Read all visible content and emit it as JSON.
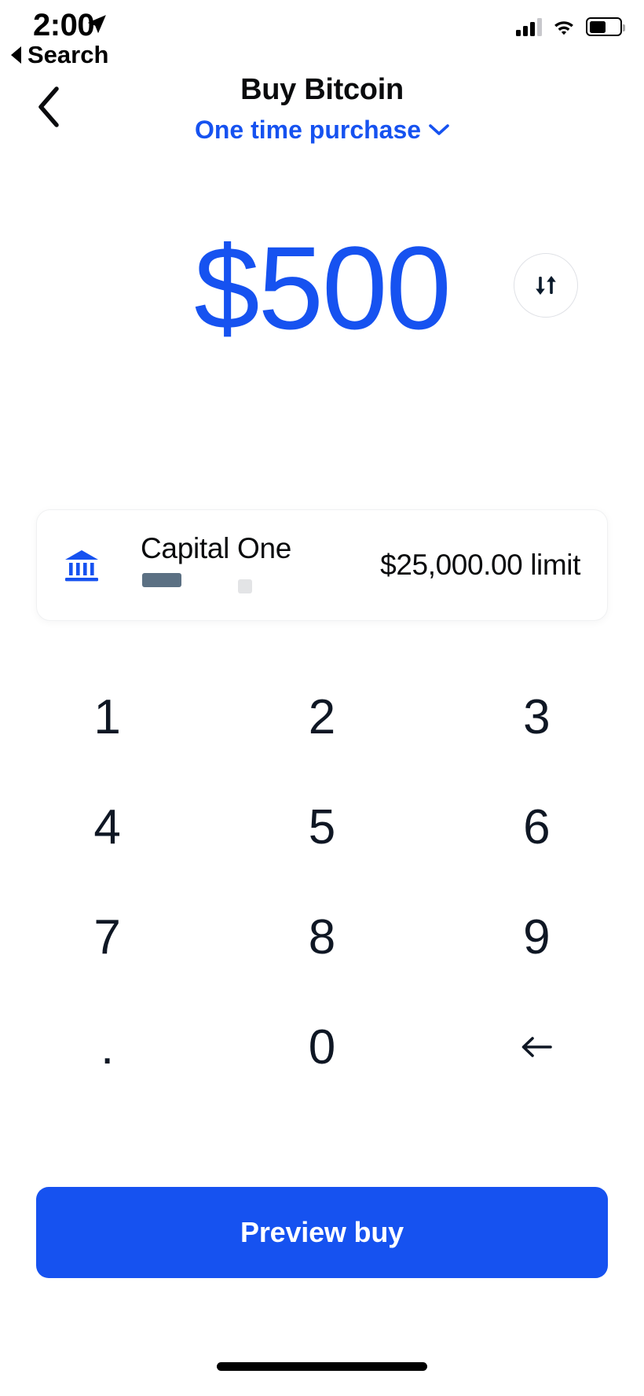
{
  "status_bar": {
    "time": "2:00",
    "location_icon": "location-arrow-icon",
    "signal_icon": "cellular-signal-icon",
    "wifi_icon": "wifi-icon",
    "battery_icon": "battery-icon",
    "battery_level_pct": 55,
    "signal_bars_filled": 3,
    "signal_bars_total": 4
  },
  "return_link": {
    "label": "Search",
    "icon": "back-triangle-icon"
  },
  "nav": {
    "back_icon": "chevron-left-icon",
    "title": "Buy Bitcoin",
    "subtitle": "One time purchase",
    "subtitle_chevron_icon": "chevron-down-icon"
  },
  "amount": {
    "value": "$500",
    "swap_icon": "swap-vertical-arrows-icon"
  },
  "payment_method": {
    "bank_icon": "bank-building-icon",
    "name": "Capital One",
    "limit": "$25,000.00 limit"
  },
  "keypad": [
    {
      "label": "1",
      "name": "key-1"
    },
    {
      "label": "2",
      "name": "key-2"
    },
    {
      "label": "3",
      "name": "key-3"
    },
    {
      "label": "4",
      "name": "key-4"
    },
    {
      "label": "5",
      "name": "key-5"
    },
    {
      "label": "6",
      "name": "key-6"
    },
    {
      "label": "7",
      "name": "key-7"
    },
    {
      "label": "8",
      "name": "key-8"
    },
    {
      "label": "9",
      "name": "key-9"
    },
    {
      "label": ".",
      "name": "key-decimal"
    },
    {
      "label": "0",
      "name": "key-0"
    },
    {
      "label": "",
      "name": "key-backspace",
      "icon": "backspace-arrow-icon"
    }
  ],
  "cta": {
    "label": "Preview buy"
  },
  "colors": {
    "brand_blue": "#1652f0",
    "text_dark": "#0a0b0d",
    "keypad_text": "#0f1724",
    "card_border": "#f0f1f2",
    "swap_border": "#dfe1e6"
  }
}
